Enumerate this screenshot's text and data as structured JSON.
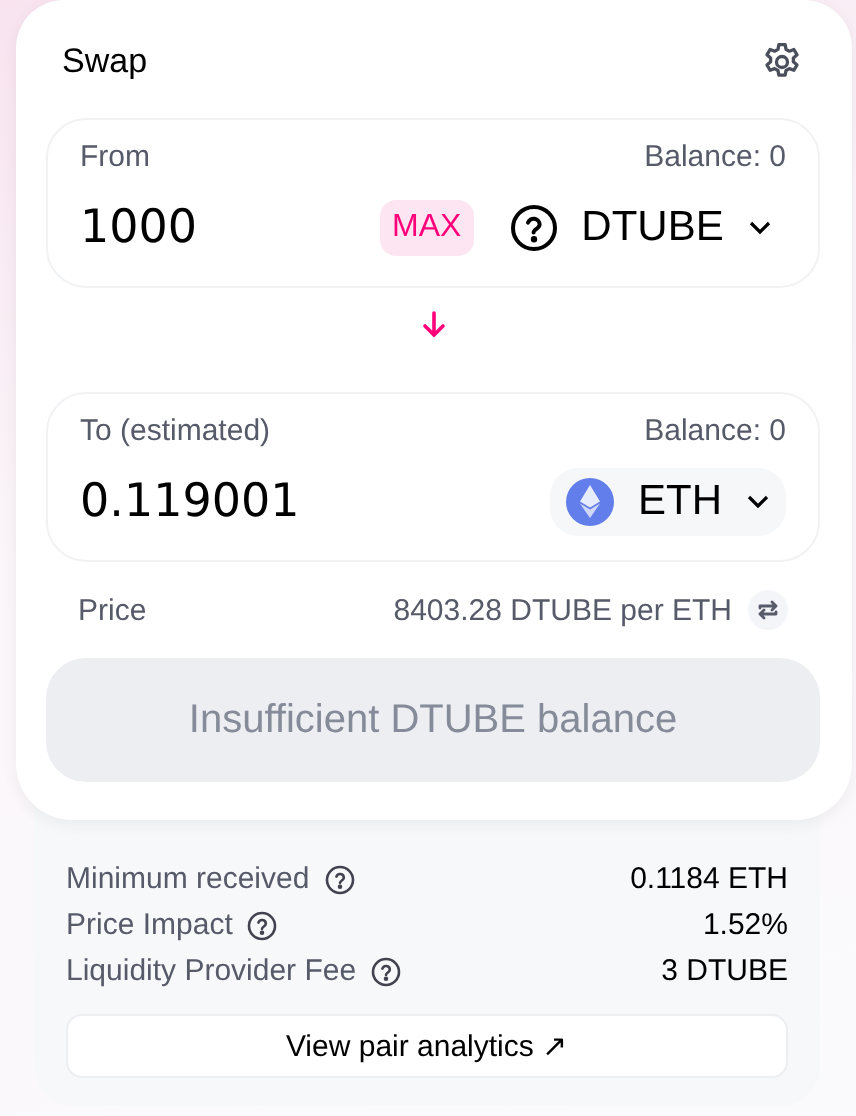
{
  "title": "Swap",
  "inputs": [
    {
      "label": "From",
      "balance": "Balance: 0",
      "amount": "1000",
      "max": "MAX",
      "token": {
        "symbol": "DTUBE",
        "kind": "unknown"
      }
    },
    {
      "label": "To (estimated)",
      "balance": "Balance: 0",
      "amount": "0.119001",
      "token": {
        "symbol": "ETH",
        "kind": "eth"
      }
    }
  ],
  "price": {
    "label": "Price",
    "value": "8403.28 DTUBE per ETH"
  },
  "action": {
    "label": "Insufficient DTUBE balance",
    "disabled": true
  },
  "details": [
    {
      "label": "Minimum received",
      "value": "0.1184 ETH"
    },
    {
      "label": "Price Impact",
      "value": "1.52%"
    },
    {
      "label": "Liquidity Provider Fee",
      "value": "3 DTUBE"
    }
  ],
  "analytics_link": "View pair analytics ↗"
}
